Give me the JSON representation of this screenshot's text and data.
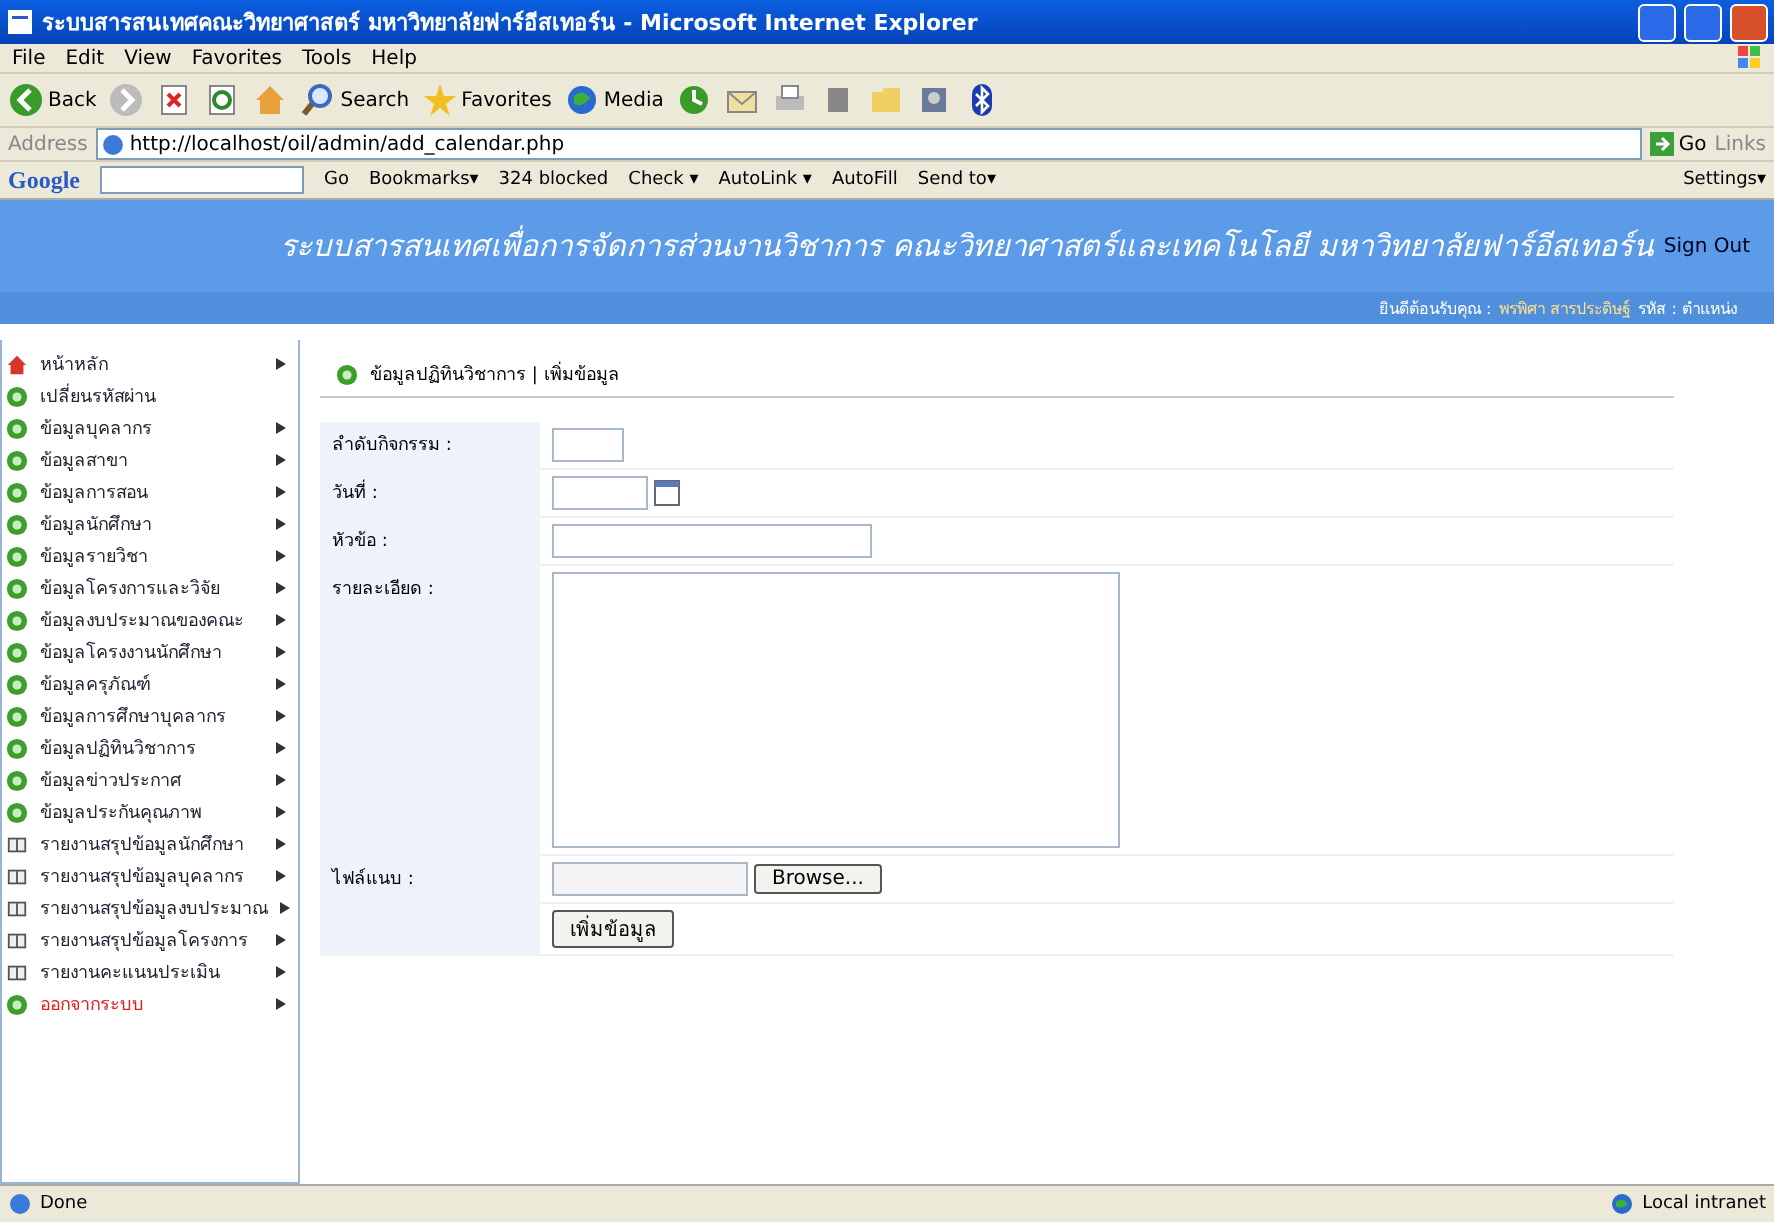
{
  "window": {
    "title": "ระบบสารสนเทศคณะวิทยาศาสตร์ มหาวิทยาลัยฟาร์อีสเทอร์น - Microsoft Internet Explorer"
  },
  "menu": [
    "File",
    "Edit",
    "View",
    "Favorites",
    "Tools",
    "Help"
  ],
  "toolbar": [
    {
      "kind": "back",
      "label": "Back"
    },
    {
      "kind": "forward"
    },
    {
      "kind": "stop"
    },
    {
      "kind": "refresh"
    },
    {
      "kind": "home"
    },
    {
      "kind": "search",
      "label": "Search"
    },
    {
      "kind": "favorites",
      "label": "Favorites"
    },
    {
      "kind": "media",
      "label": "Media"
    },
    {
      "kind": "history"
    },
    {
      "kind": "mail"
    },
    {
      "kind": "print"
    },
    {
      "kind": "edit"
    },
    {
      "kind": "folder"
    },
    {
      "kind": "messenger"
    },
    {
      "kind": "bluetooth"
    }
  ],
  "address": {
    "label": "Address",
    "value": "http://localhost/oil/admin/add_calendar.php",
    "go": "Go",
    "links": "Links"
  },
  "google_bar": {
    "logo": "Google",
    "go": "Go",
    "items": [
      "Bookmarks▾",
      "324 blocked",
      "Check ▾",
      "AutoLink ▾",
      "AutoFill",
      "Send to▾"
    ],
    "settings": "Settings▾"
  },
  "header": {
    "title": "ระบบสารสนเทศเพื่อการจัดการส่วนงานวิชาการ คณะวิทยาศาสตร์และเทคโนโลยี มหาวิทยาลัยฟาร์อีสเทอร์น",
    "sign_out": "Sign Out",
    "welcome": "ยินดีต้อนรับคุณ :",
    "user": "พรพิศา สารประดิษฐ์",
    "role": "รหัส : ตำแหน่ง"
  },
  "sidebar": {
    "items": [
      {
        "kind": "home",
        "label": "หน้าหลัก",
        "has_submenu": true
      },
      {
        "kind": "add",
        "label": "เปลี่ยนรหัสผ่าน",
        "has_submenu": false
      },
      {
        "kind": "add",
        "label": "ข้อมูลบุคลากร",
        "has_submenu": true
      },
      {
        "kind": "add",
        "label": "ข้อมูลสาขา",
        "has_submenu": true
      },
      {
        "kind": "add",
        "label": "ข้อมูลการสอน",
        "has_submenu": true
      },
      {
        "kind": "add",
        "label": "ข้อมูลนักศึกษา",
        "has_submenu": true
      },
      {
        "kind": "add",
        "label": "ข้อมูลรายวิชา",
        "has_submenu": true
      },
      {
        "kind": "add",
        "label": "ข้อมูลโครงการและวิจัย",
        "has_submenu": true
      },
      {
        "kind": "add",
        "label": "ข้อมูลงบประมาณของคณะ",
        "has_submenu": true
      },
      {
        "kind": "add",
        "label": "ข้อมูลโครงงานนักศึกษา",
        "has_submenu": true
      },
      {
        "kind": "add",
        "label": "ข้อมูลครุภัณฑ์",
        "has_submenu": true
      },
      {
        "kind": "add",
        "label": "ข้อมูลการศึกษาบุคลากร",
        "has_submenu": true
      },
      {
        "kind": "add",
        "label": "ข้อมูลปฏิทินวิชาการ",
        "has_submenu": true
      },
      {
        "kind": "add",
        "label": "ข้อมูลข่าวประกาศ",
        "has_submenu": true
      },
      {
        "kind": "add",
        "label": "ข้อมูลประกันคุณภาพ",
        "has_submenu": true
      },
      {
        "kind": "report",
        "label": "รายงานสรุปข้อมูลนักศึกษา",
        "has_submenu": true
      },
      {
        "kind": "report",
        "label": "รายงานสรุปข้อมูลบุคลากร",
        "has_submenu": true
      },
      {
        "kind": "report",
        "label": "รายงานสรุปข้อมูลงบประมาณ",
        "has_submenu": true
      },
      {
        "kind": "report",
        "label": "รายงานสรุปข้อมูลโครงการ",
        "has_submenu": true
      },
      {
        "kind": "report",
        "label": "รายงานคะแนนประเมิน",
        "has_submenu": true
      },
      {
        "kind": "exit",
        "label": "ออกจากระบบ",
        "has_submenu": true
      }
    ]
  },
  "form": {
    "breadcrumb": "ข้อมูลปฏิทินวิชาการ | เพิ่มข้อมูล",
    "fields": [
      {
        "kind": "short",
        "label": "ลำดับกิจกรรม :"
      },
      {
        "kind": "date",
        "label": "วันที่ :"
      },
      {
        "kind": "text",
        "label": "หัวข้อ :"
      },
      {
        "kind": "textarea",
        "label": "รายละเอียด :"
      },
      {
        "kind": "file",
        "label": "ไฟล์แนบ :",
        "button": "Browse..."
      }
    ],
    "submit": "เพิ่มข้อมูล"
  },
  "status_bar": {
    "text": "Done",
    "zone": "Local intranet"
  }
}
